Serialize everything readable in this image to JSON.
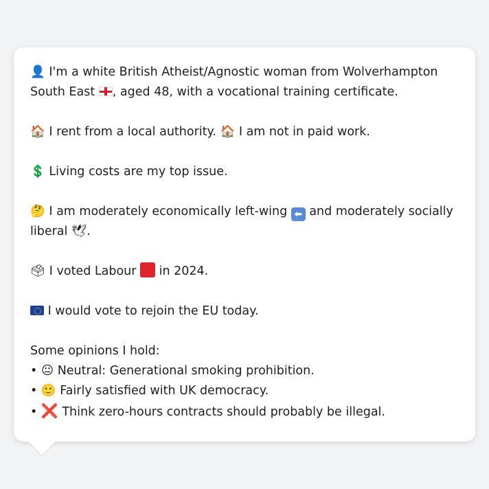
{
  "profile": {
    "identity": {
      "icon": "👤",
      "text_before_flag": " I'm a white British Atheist/Agnostic woman from Wolverhampton South East ",
      "flag": "england-flag",
      "text_after_flag": ", aged 48, with a vocational training certificate."
    },
    "housing": {
      "icon1": "🏠",
      "text1": " I rent from a local authority. ",
      "icon2": "🏠",
      "text2": " I am not in paid work."
    },
    "issue": {
      "icon": "💲",
      "text": " Living costs are my top issue."
    },
    "ideology": {
      "icon": "🤔",
      "text_before_arrow": " I am moderately economically left-wing ",
      "arrow": "⬅",
      "text_after_arrow": " and moderately socially liberal ",
      "dove": "🕊",
      "end": "."
    },
    "vote": {
      "icon": "🗳",
      "text_before": " I voted Labour ",
      "text_after": " in 2024."
    },
    "eu": {
      "flag": "eu-flag",
      "text": " I would vote to rejoin the EU today."
    },
    "opinions": {
      "heading": "Some opinions I hold:",
      "items": [
        {
          "bullet": "• ",
          "icon": "😐",
          "text": " Neutral: Generational smoking prohibition."
        },
        {
          "bullet": "• ",
          "icon": "🙂",
          "text": " Fairly satisfied with UK democracy."
        },
        {
          "bullet": "• ",
          "icon": "❌",
          "text": " Think zero-hours contracts should probably be illegal."
        }
      ]
    }
  },
  "colors": {
    "background": "#f2f3f5",
    "card": "#ffffff",
    "text": "#1f1f1f",
    "labour_red": "#e0242f"
  }
}
